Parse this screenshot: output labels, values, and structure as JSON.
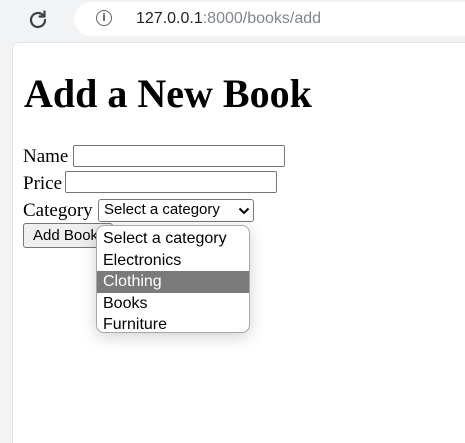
{
  "browser": {
    "url_host": "127.0.0.1",
    "url_rest": ":8000/books/add",
    "info_glyph": "i"
  },
  "page": {
    "title": "Add a New Book",
    "fields": {
      "name_label": "Name",
      "name_value": "",
      "price_label": "Price",
      "price_value": "",
      "category_label": "Category",
      "category_selected": "Select a category"
    },
    "submit_label": "Add Book"
  },
  "dropdown": {
    "options": [
      "Select a category",
      "Electronics",
      "Clothing",
      "Books",
      "Furniture"
    ],
    "highlighted": "Clothing"
  }
}
